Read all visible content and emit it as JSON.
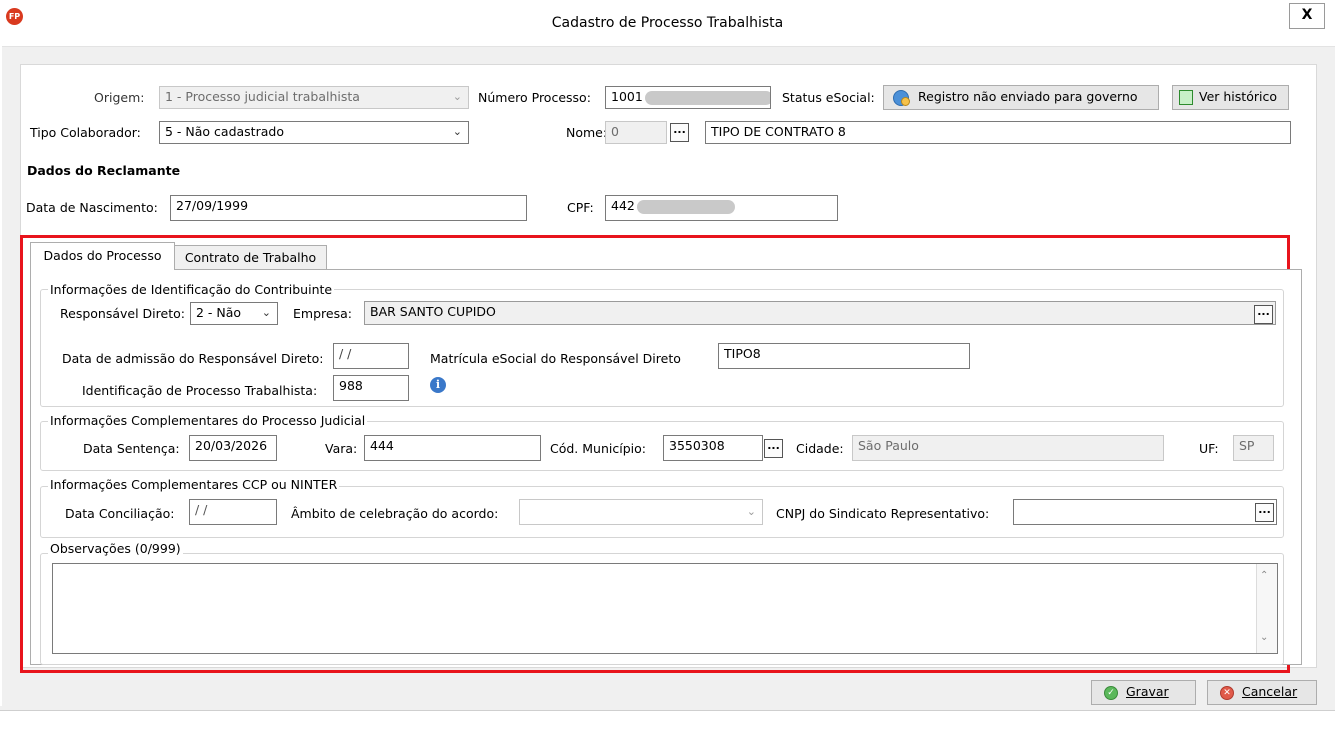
{
  "window": {
    "title": "Cadastro de Processo Trabalhista",
    "app_icon_text": "FP",
    "close_label": "X"
  },
  "header_form": {
    "origem_label": "Origem:",
    "origem_value": "1 - Processo judicial trabalhista",
    "numero_processo_label": "Número Processo:",
    "numero_processo_value": "1001",
    "status_esocial_label": "Status eSocial:",
    "status_button_label": "Registro não enviado para governo",
    "ver_historico_label": "Ver histórico",
    "tipo_colaborador_label": "Tipo Colaborador:",
    "tipo_colaborador_value": "5 - Não cadastrado",
    "nome_label": "Nome:",
    "nome_code_value": "0",
    "nome_value": "TIPO DE CONTRATO 8"
  },
  "reclamante": {
    "section_title": "Dados do Reclamante",
    "data_nascimento_label": "Data de Nascimento:",
    "data_nascimento_value": "27/09/1999",
    "cpf_label": "CPF:",
    "cpf_value": "442"
  },
  "tabs": [
    {
      "label": "Dados do Processo",
      "active": true
    },
    {
      "label": "Contrato de Trabalho",
      "active": false
    }
  ],
  "identificacao": {
    "group_title": "Informações de Identificação do Contribuinte",
    "responsavel_label": "Responsável Direto:",
    "responsavel_value": "2 - Não",
    "empresa_label": "Empresa:",
    "empresa_value": "BAR SANTO CUPIDO",
    "data_admissao_label": "Data de admissão do Responsável Direto:",
    "data_admissao_value": "/ /",
    "matricula_label": "Matrícula eSocial do Responsável Direto",
    "matricula_value": "TIPO8",
    "id_processo_label": "Identificação de Processo Trabalhista:",
    "id_processo_value": "988"
  },
  "judicial": {
    "group_title": "Informações Complementares do Processo Judicial",
    "data_sentenca_label": "Data Sentença:",
    "data_sentenca_value": "20/03/2026",
    "vara_label": "Vara:",
    "vara_value": "444",
    "cod_municipio_label": "Cód. Município:",
    "cod_municipio_value": "3550308",
    "cidade_label": "Cidade:",
    "cidade_value": "São Paulo",
    "uf_label": "UF:",
    "uf_value": "SP"
  },
  "ccp": {
    "group_title": "Informações Complementares CCP ou NINTER",
    "data_conciliacao_label": "Data Conciliação:",
    "data_conciliacao_value": "/ /",
    "ambito_label": "Âmbito de celebração do acordo:",
    "ambito_value": "",
    "cnpj_label": "CNPJ do Sindicato Representativo:",
    "cnpj_value": ""
  },
  "observacoes": {
    "group_title": "Observações (0/999)",
    "value": ""
  },
  "footer": {
    "gravar_label": "Gravar",
    "cancelar_label": "Cancelar"
  },
  "colors": {
    "highlight_border": "#e8141c",
    "app_icon": "#d93a1f"
  }
}
